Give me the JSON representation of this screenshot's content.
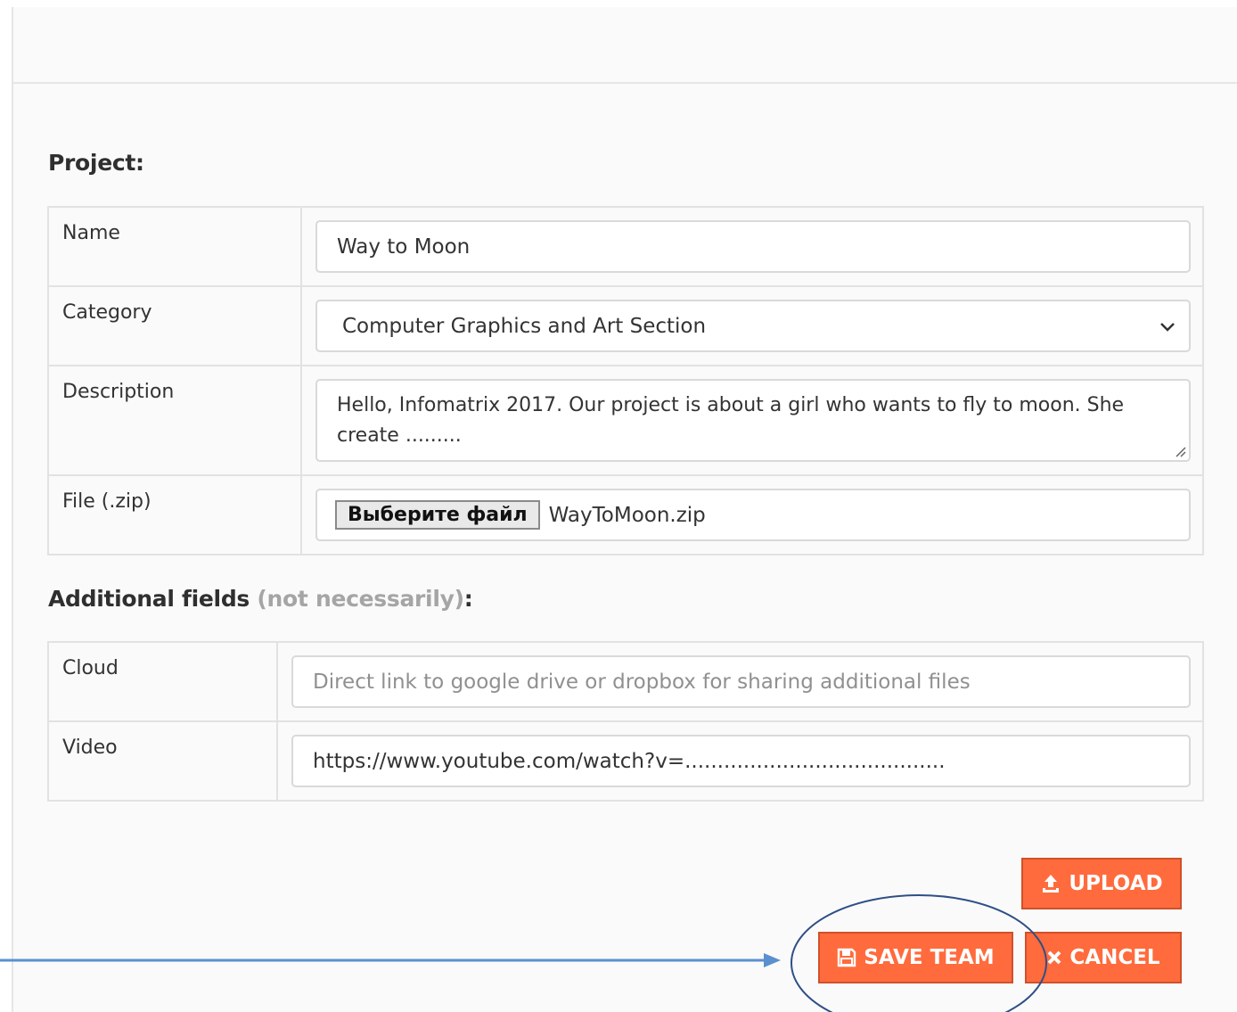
{
  "project": {
    "title": "Project:",
    "name_label": "Name",
    "name_value": "Way to Moon",
    "category_label": "Category",
    "category_value": "Computer Graphics and Art Section",
    "description_label": "Description",
    "description_value": "Hello, Infomatrix 2017. Our project is about a girl who wants to fly to moon. She create .........",
    "file_label": "File (.zip)",
    "file_button_label": "Выберите файл",
    "file_name": "WayToMoon.zip"
  },
  "additional": {
    "title_main": "Additional fields",
    "title_note": "(not necessarily)",
    "title_colon": ":",
    "cloud_label": "Cloud",
    "cloud_placeholder": "Direct link to google drive or dropbox for sharing additional files",
    "video_label": "Video",
    "video_value": "https://www.youtube.com/watch?v=........................................"
  },
  "buttons": {
    "upload": "UPLOAD",
    "save": "SAVE TEAM",
    "cancel": "CANCEL"
  },
  "icons": {
    "upload": "upload-icon",
    "save": "floppy-disk-icon",
    "cancel": "close-icon",
    "select": "chevron-down-icon"
  },
  "colors": {
    "accent": "#ff6b3d",
    "annotation": "#5b8fd0"
  }
}
